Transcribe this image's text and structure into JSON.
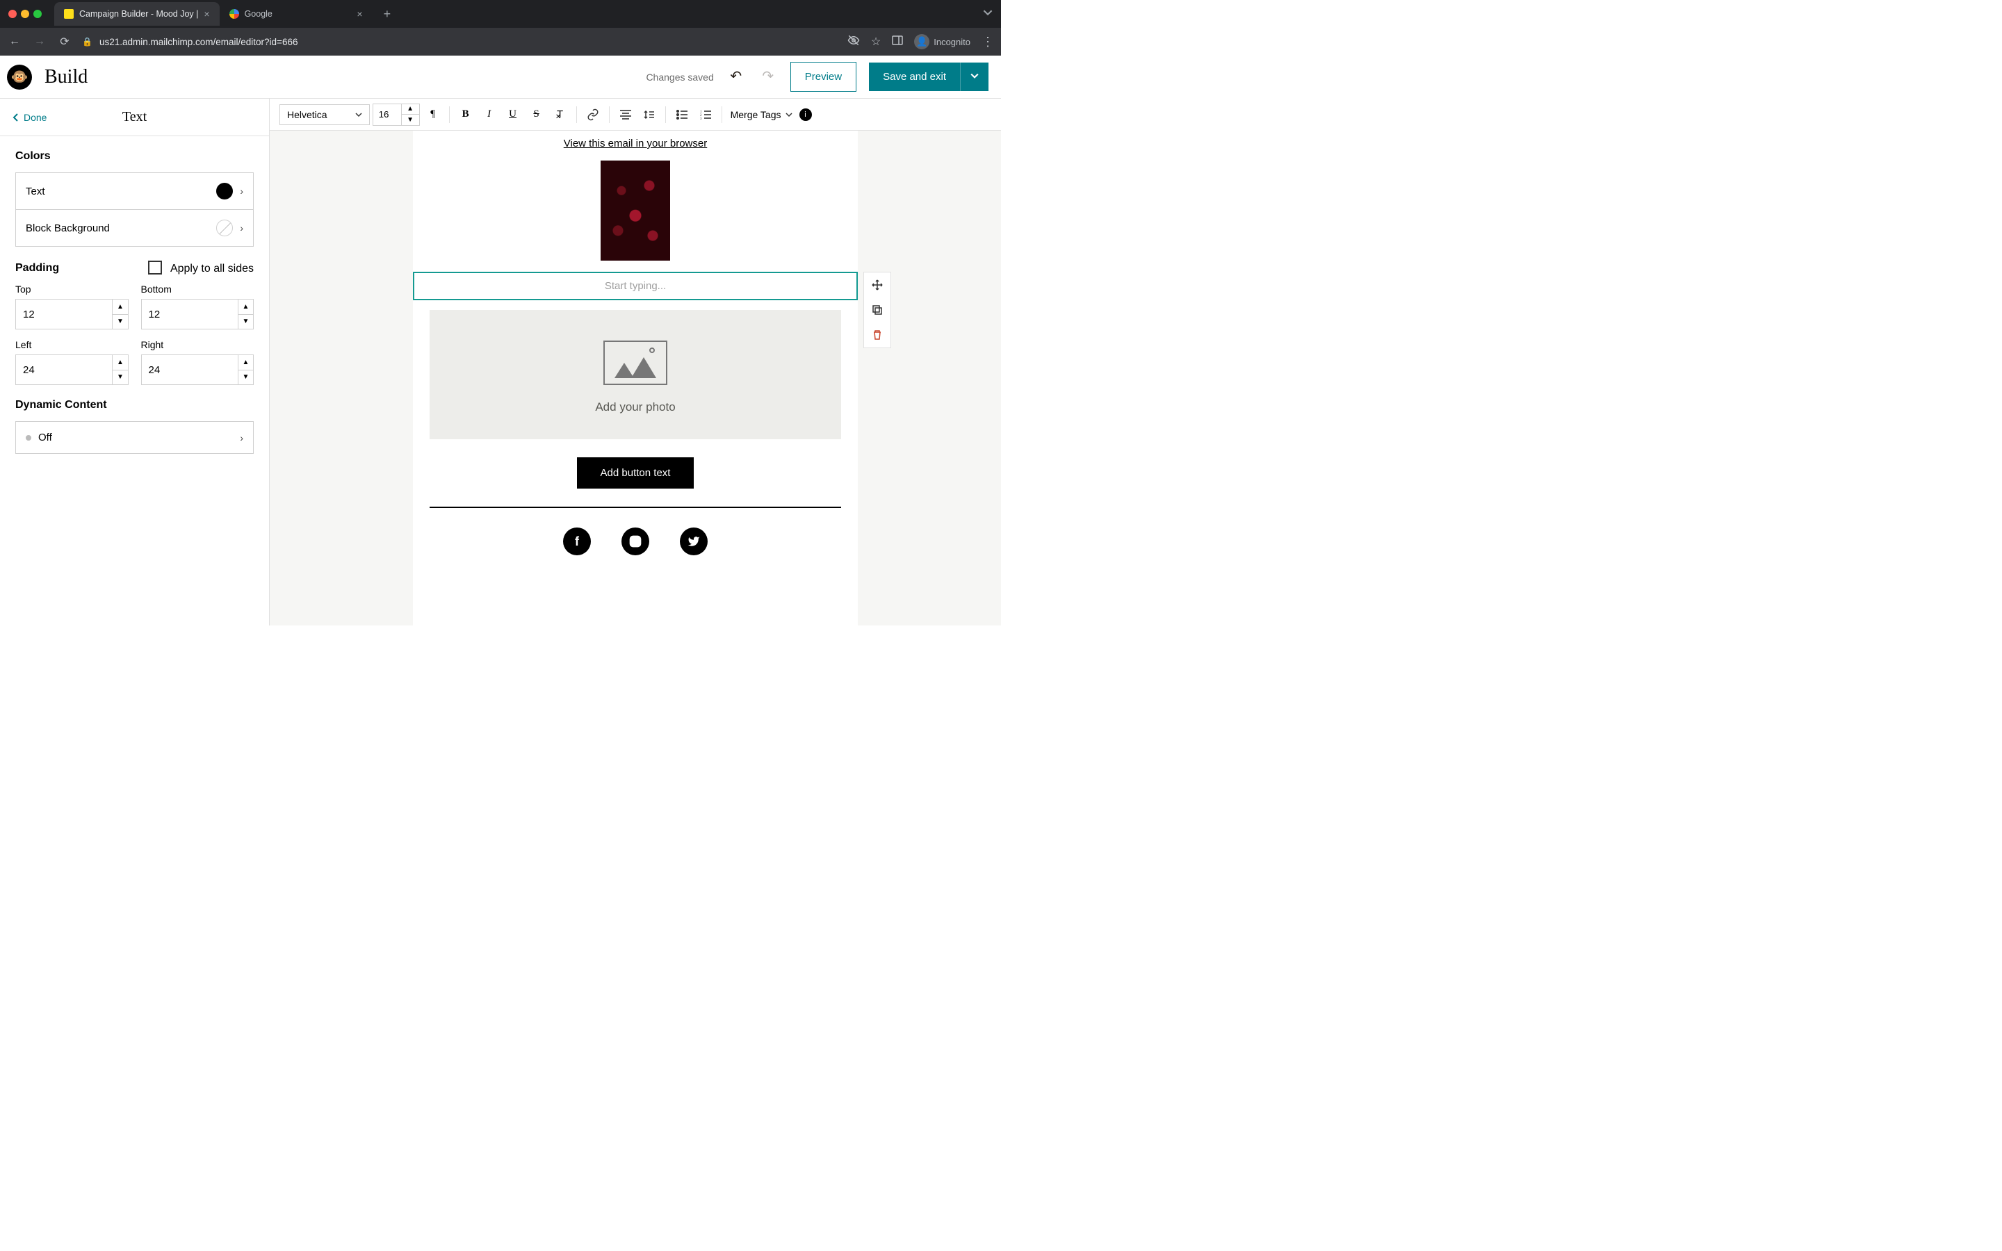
{
  "browser": {
    "tabs": [
      {
        "title": "Campaign Builder - Mood Joy |",
        "active": true,
        "favicon": "mc"
      },
      {
        "title": "Google",
        "active": false,
        "favicon": "g"
      }
    ],
    "url": "us21.admin.mailchimp.com/email/editor?id=666",
    "incognito_label": "Incognito"
  },
  "appbar": {
    "title": "Build",
    "status": "Changes saved",
    "preview": "Preview",
    "save": "Save and exit"
  },
  "panel": {
    "done": "Done",
    "title": "Text",
    "sections": {
      "colors": {
        "heading": "Colors",
        "text_label": "Text",
        "bg_label": "Block Background"
      },
      "padding": {
        "heading": "Padding",
        "apply_all": "Apply to all sides",
        "top_label": "Top",
        "top_value": "12",
        "bottom_label": "Bottom",
        "bottom_value": "12",
        "left_label": "Left",
        "left_value": "24",
        "right_label": "Right",
        "right_value": "24"
      },
      "dynamic": {
        "heading": "Dynamic Content",
        "value": "Off"
      }
    }
  },
  "toolbar": {
    "font": "Helvetica",
    "size": "16",
    "merge": "Merge Tags"
  },
  "email": {
    "view_link": "View this email in your browser",
    "text_placeholder": "Start typing...",
    "photo_caption": "Add your photo",
    "cta": "Add button text"
  }
}
